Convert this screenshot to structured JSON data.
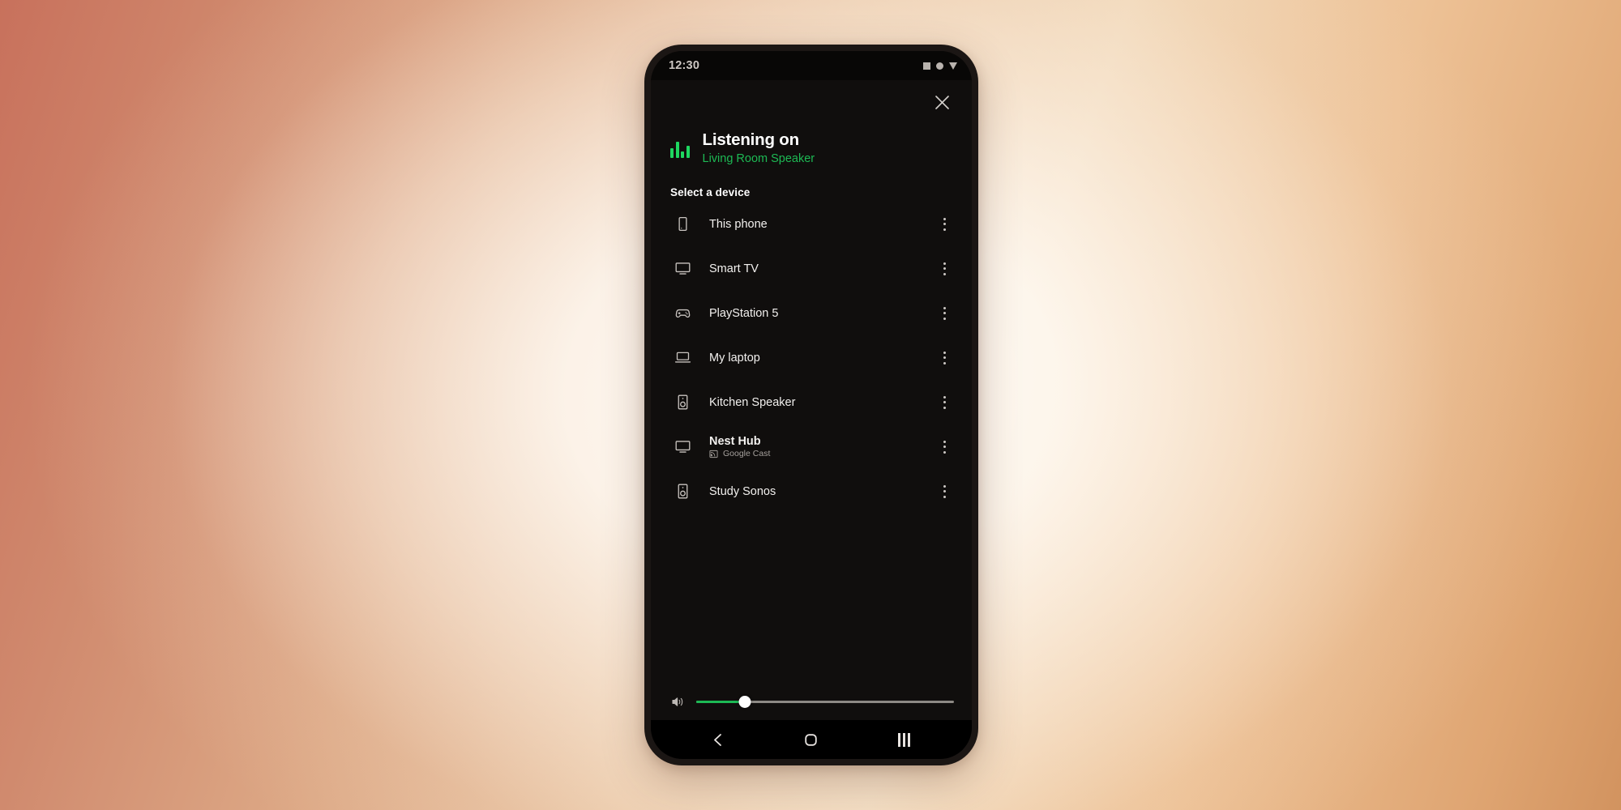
{
  "status_bar": {
    "time": "12:30",
    "icons": [
      "square-indicator-icon",
      "circle-indicator-icon",
      "triangle-indicator-icon"
    ]
  },
  "sheet": {
    "close_icon": "close-icon",
    "eq_icon": "equalizer-icon",
    "title": "Listening on",
    "active_device": "Living Room Speaker",
    "section_label": "Select a device",
    "accent_green": "#1db954",
    "eq_green": "#1ed760",
    "background": "#100e0d"
  },
  "devices": [
    {
      "name": "This phone",
      "icon": "phone-icon",
      "subtitle": null,
      "sub_icon": null
    },
    {
      "name": "Smart TV",
      "icon": "tv-icon",
      "subtitle": null,
      "sub_icon": null
    },
    {
      "name": "PlayStation 5",
      "icon": "gamepad-icon",
      "subtitle": null,
      "sub_icon": null
    },
    {
      "name": "My laptop",
      "icon": "laptop-icon",
      "subtitle": null,
      "sub_icon": null
    },
    {
      "name": "Kitchen Speaker",
      "icon": "speaker-icon",
      "subtitle": null,
      "sub_icon": null
    },
    {
      "name": "Nest Hub",
      "icon": "tv-icon",
      "subtitle": "Google Cast",
      "sub_icon": "google-cast-icon"
    },
    {
      "name": "Study Sonos",
      "icon": "speaker-icon",
      "subtitle": null,
      "sub_icon": null
    }
  ],
  "row_menu_icon": "overflow-menu-icon",
  "volume": {
    "icon": "volume-icon",
    "level_percent": 19,
    "fill_color": "#1db954",
    "track_color": "#8d8984"
  },
  "nav_bar": {
    "back": "back-icon",
    "home": "home-icon",
    "recents": "recents-icon"
  }
}
